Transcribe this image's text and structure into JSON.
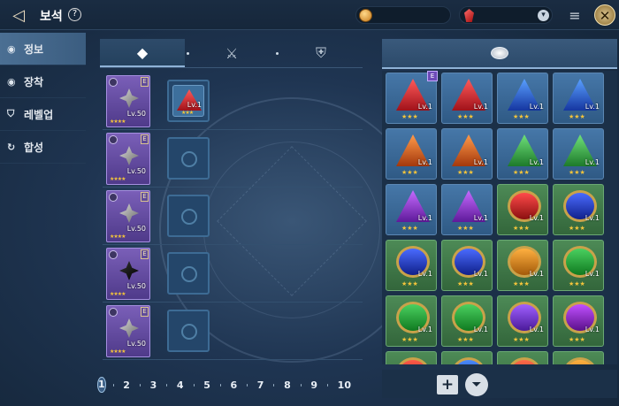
{
  "header": {
    "title": "보석",
    "help": "?",
    "close": "✕",
    "back": "◁",
    "add_currency": "▾",
    "stack_icon": "≡"
  },
  "sidebar": {
    "items": [
      {
        "label": "정보",
        "icon": "gem-icon",
        "active": true
      },
      {
        "label": "장착",
        "icon": "gem-icon",
        "active": false
      },
      {
        "label": "레벨업",
        "icon": "shield-icon",
        "active": false
      },
      {
        "label": "합성",
        "icon": "cycle-icon",
        "active": false
      }
    ]
  },
  "tabs": {
    "t1": "◆",
    "t2": "⚔",
    "t3": "⛨"
  },
  "equip_slots": [
    {
      "grade": "E",
      "level": "Lv.50",
      "stars": "★★★★",
      "socket_gem_level": "Lv.1",
      "socket_gem_stars": "★★★"
    },
    {
      "grade": "E",
      "level": "Lv.50",
      "stars": "★★★★"
    },
    {
      "grade": "E",
      "level": "Lv.50",
      "stars": "★★★★"
    },
    {
      "grade": "E",
      "level": "Lv.50",
      "stars": "★★★★"
    },
    {
      "grade": "E",
      "level": "Lv.50",
      "stars": "★★★★"
    }
  ],
  "pager": {
    "pages": [
      "1",
      "2",
      "3",
      "4",
      "5",
      "6",
      "7",
      "8",
      "9",
      "10"
    ],
    "current": "1",
    "current_badge": "E"
  },
  "inventory": {
    "badge": "E",
    "add": "+",
    "filter": "⏷",
    "level": "Lv.1",
    "stars": "★★★"
  },
  "colors": {
    "accent": "#8fb2d6",
    "gold": "#f3c43b"
  }
}
